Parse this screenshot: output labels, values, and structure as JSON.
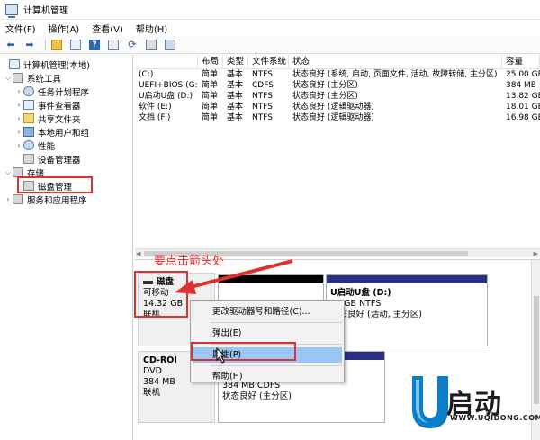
{
  "window": {
    "title": "计算机管理"
  },
  "menu": [
    "文件(F)",
    "操作(A)",
    "查看(V)",
    "帮助(H)"
  ],
  "toolbar": {
    "help_glyph": "?"
  },
  "tree": {
    "root": "计算机管理(本地)",
    "system_tools": "系统工具",
    "task_scheduler": "任务计划程序",
    "event_viewer": "事件查看器",
    "shared_folders": "共享文件夹",
    "local_users": "本地用户和组",
    "performance": "性能",
    "device_manager": "设备管理器",
    "storage": "存储",
    "disk_management": "磁盘管理",
    "services": "服务和应用程序"
  },
  "volumes": {
    "headers": [
      "",
      "布局",
      "类型",
      "文件系统",
      "状态",
      "容量"
    ],
    "rows": [
      [
        "(C:)",
        "简单",
        "基本",
        "NTFS",
        "状态良好 (系统, 启动, 页面文件, 活动, 故障转储, 主分区)",
        "25.00 GB"
      ],
      [
        "UEFI+BIOS (G:)",
        "简单",
        "基本",
        "CDFS",
        "状态良好 (主分区)",
        "384 MB"
      ],
      [
        "U启动U盘 (D:)",
        "简单",
        "基本",
        "NTFS",
        "状态良好 (主分区)",
        "13.82 GB"
      ],
      [
        "软件 (E:)",
        "简单",
        "基本",
        "NTFS",
        "状态良好 (逻辑驱动器)",
        "18.01 GB"
      ],
      [
        "文档 (F:)",
        "简单",
        "基本",
        "NTFS",
        "状态良好 (逻辑驱动器)",
        "16.98 GB"
      ]
    ]
  },
  "annotation": "要点击箭头处",
  "disk1": {
    "name": "磁盘",
    "type": "可移动",
    "size": "14.32 GB",
    "status": "联机"
  },
  "partition_usb": {
    "name": "U启动U盘  (D:)",
    "size": "82 GB NTFS",
    "status": "状态良好 (活动, 主分区)"
  },
  "cdrom": {
    "name": "CD-ROI",
    "type": "DVD",
    "size": "384 MB",
    "status": "联机"
  },
  "partition_cd": {
    "size": "384 MB CDFS",
    "status": "状态良好 (主分区)"
  },
  "context_menu": {
    "change_letter": "更改驱动器号和路径(C)...",
    "eject": "弹出(E)",
    "properties": "属性(P)",
    "help": "帮助(H)"
  },
  "watermark": {
    "brand": "启动",
    "url": "WWW.UQIDONG.COM"
  },
  "colors": {
    "annotation_red": "#e03131",
    "highlight": "#9ac7f3",
    "partition_bar": "#2a2f86"
  }
}
